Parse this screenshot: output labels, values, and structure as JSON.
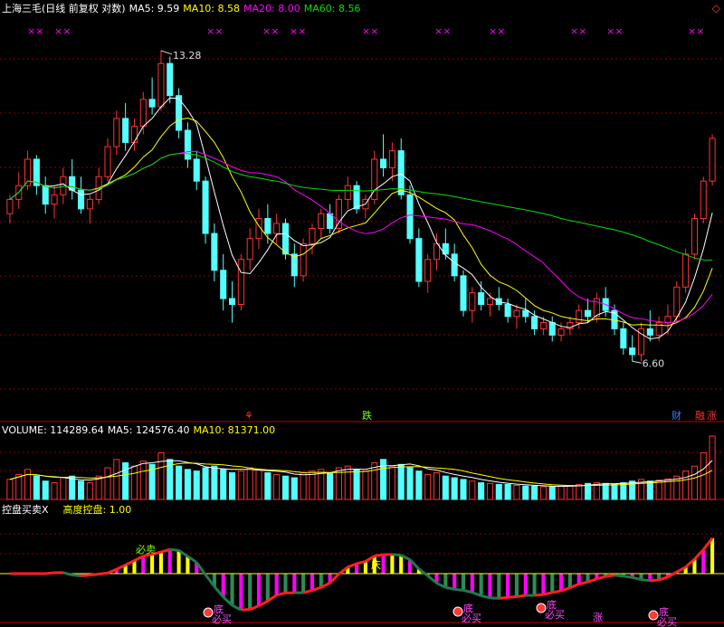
{
  "header": {
    "title": "上海三毛(日线 前复权 对数)",
    "ma5_label": "MA5: 9.59",
    "ma10_label": "MA10: 8.58",
    "ma20_label": "MA20: 8.00",
    "ma60_label": "MA60: 8.56",
    "close_glyph": "◇"
  },
  "volume_header": {
    "label": "VOLUME: 114289.64",
    "ma5_label": "MA5: 124576.40",
    "ma10_label": "MA10: 81371.00"
  },
  "indicator_header": {
    "name": "控盘买卖X",
    "value_label": "高度控盘: 1.00"
  },
  "annotations": {
    "high": "13.28",
    "low": "6.60",
    "signal_fall": "跌",
    "signal_sell": "必卖",
    "signal_bottom": "底",
    "signal_buy": "必买",
    "signal_rise": "涨",
    "badge_cai": "财",
    "badge_rong": "融",
    "badge_zhang": "涨",
    "mark_x": "××",
    "mark_fu": "⚘",
    "signal_qi": "庆"
  },
  "colors": {
    "up": "#ff3232",
    "down": "#54ffff",
    "ma5": "#ffffff",
    "ma10": "#ffff00",
    "ma20": "#ff00ff",
    "ma60": "#00e000",
    "grid": "#8b0000",
    "mark": "#ff00ff"
  },
  "chart_data": [
    {
      "type": "candlestick",
      "title": "上海三毛(日线 前复权 对数)",
      "ylim": [
        6.2,
        14.0
      ],
      "scale": "log",
      "ohlc": [
        [
          9.2,
          9.6,
          9.0,
          9.5
        ],
        [
          9.5,
          10.1,
          9.3,
          9.8
        ],
        [
          9.8,
          10.6,
          9.7,
          10.4
        ],
        [
          10.4,
          10.5,
          9.6,
          9.8
        ],
        [
          9.8,
          10.0,
          9.2,
          9.4
        ],
        [
          9.4,
          9.8,
          9.1,
          9.6
        ],
        [
          9.6,
          10.2,
          9.4,
          10.0
        ],
        [
          10.0,
          10.4,
          9.5,
          9.7
        ],
        [
          9.7,
          10.0,
          9.2,
          9.3
        ],
        [
          9.3,
          9.6,
          9.0,
          9.5
        ],
        [
          9.5,
          10.2,
          9.4,
          10.0
        ],
        [
          10.0,
          10.9,
          9.9,
          10.7
        ],
        [
          10.7,
          11.6,
          10.5,
          11.4
        ],
        [
          11.4,
          11.8,
          10.6,
          10.8
        ],
        [
          10.8,
          11.4,
          10.6,
          11.2
        ],
        [
          11.2,
          12.1,
          11.0,
          11.9
        ],
        [
          11.9,
          12.5,
          11.5,
          11.7
        ],
        [
          11.7,
          13.28,
          11.6,
          12.9
        ],
        [
          12.9,
          13.1,
          11.8,
          12.0
        ],
        [
          12.0,
          12.2,
          10.9,
          11.1
        ],
        [
          11.1,
          11.3,
          10.2,
          10.4
        ],
        [
          10.4,
          10.6,
          9.7,
          9.9
        ],
        [
          9.9,
          10.0,
          8.6,
          8.8
        ],
        [
          8.8,
          9.0,
          7.9,
          8.1
        ],
        [
          8.1,
          8.4,
          7.4,
          7.6
        ],
        [
          7.6,
          7.9,
          7.2,
          7.5
        ],
        [
          7.5,
          8.4,
          7.4,
          8.3
        ],
        [
          8.3,
          8.9,
          8.1,
          8.7
        ],
        [
          8.7,
          9.3,
          8.5,
          9.1
        ],
        [
          9.1,
          9.4,
          8.6,
          8.8
        ],
        [
          8.8,
          9.2,
          8.6,
          9.0
        ],
        [
          9.0,
          9.1,
          8.3,
          8.4
        ],
        [
          8.4,
          8.6,
          7.8,
          8.0
        ],
        [
          8.0,
          8.7,
          7.9,
          8.6
        ],
        [
          8.6,
          9.0,
          8.4,
          8.9
        ],
        [
          8.9,
          9.3,
          8.7,
          9.2
        ],
        [
          9.2,
          9.4,
          8.8,
          8.9
        ],
        [
          8.9,
          9.6,
          8.8,
          9.5
        ],
        [
          9.5,
          10.0,
          9.3,
          9.8
        ],
        [
          9.8,
          9.9,
          9.2,
          9.3
        ],
        [
          9.3,
          9.6,
          9.1,
          9.5
        ],
        [
          9.5,
          10.6,
          9.4,
          10.4
        ],
        [
          10.4,
          11.0,
          10.0,
          10.2
        ],
        [
          10.2,
          10.8,
          9.9,
          10.6
        ],
        [
          10.6,
          10.9,
          9.5,
          9.6
        ],
        [
          9.6,
          9.8,
          8.6,
          8.7
        ],
        [
          8.7,
          8.9,
          7.8,
          7.9
        ],
        [
          7.9,
          8.4,
          7.7,
          8.3
        ],
        [
          8.3,
          8.8,
          8.1,
          8.6
        ],
        [
          8.6,
          8.9,
          8.3,
          8.4
        ],
        [
          8.4,
          8.6,
          7.9,
          8.0
        ],
        [
          8.0,
          8.1,
          7.3,
          7.4
        ],
        [
          7.4,
          7.8,
          7.2,
          7.7
        ],
        [
          7.7,
          7.9,
          7.4,
          7.5
        ],
        [
          7.5,
          7.7,
          7.3,
          7.6
        ],
        [
          7.6,
          7.8,
          7.4,
          7.5
        ],
        [
          7.5,
          7.6,
          7.2,
          7.3
        ],
        [
          7.3,
          7.5,
          7.1,
          7.4
        ],
        [
          7.4,
          7.6,
          7.2,
          7.3
        ],
        [
          7.3,
          7.4,
          7.0,
          7.1
        ],
        [
          7.1,
          7.3,
          7.0,
          7.2
        ],
        [
          7.2,
          7.3,
          6.9,
          7.0
        ],
        [
          7.0,
          7.2,
          6.9,
          7.1
        ],
        [
          7.1,
          7.3,
          7.0,
          7.2
        ],
        [
          7.2,
          7.5,
          7.1,
          7.4
        ],
        [
          7.4,
          7.6,
          7.2,
          7.3
        ],
        [
          7.3,
          7.7,
          7.2,
          7.6
        ],
        [
          7.6,
          7.8,
          7.3,
          7.4
        ],
        [
          7.4,
          7.5,
          7.0,
          7.1
        ],
        [
          7.1,
          7.2,
          6.7,
          6.8
        ],
        [
          6.8,
          7.0,
          6.6,
          6.7
        ],
        [
          6.7,
          7.2,
          6.6,
          7.1
        ],
        [
          7.1,
          7.4,
          6.9,
          7.0
        ],
        [
          7.0,
          7.3,
          6.9,
          7.2
        ],
        [
          7.2,
          7.5,
          7.0,
          7.3
        ],
        [
          7.3,
          7.9,
          7.2,
          7.8
        ],
        [
          7.8,
          8.5,
          7.7,
          8.4
        ],
        [
          8.4,
          9.2,
          8.3,
          9.1
        ],
        [
          9.1,
          10.0,
          9.0,
          9.9
        ],
        [
          9.9,
          11.0,
          9.8,
          10.9
        ]
      ]
    },
    {
      "type": "bar",
      "title": "VOLUME",
      "values": [
        60,
        75,
        90,
        70,
        55,
        50,
        65,
        70,
        55,
        50,
        70,
        95,
        120,
        110,
        100,
        115,
        105,
        140,
        120,
        100,
        90,
        85,
        95,
        100,
        90,
        80,
        85,
        95,
        90,
        80,
        75,
        70,
        65,
        80,
        85,
        90,
        80,
        95,
        100,
        90,
        85,
        110,
        120,
        100,
        105,
        95,
        85,
        75,
        80,
        70,
        65,
        60,
        55,
        50,
        48,
        45,
        45,
        42,
        40,
        40,
        38,
        38,
        40,
        42,
        45,
        48,
        50,
        48,
        45,
        50,
        55,
        60,
        55,
        58,
        62,
        70,
        85,
        100,
        140,
        190
      ]
    }
  ]
}
